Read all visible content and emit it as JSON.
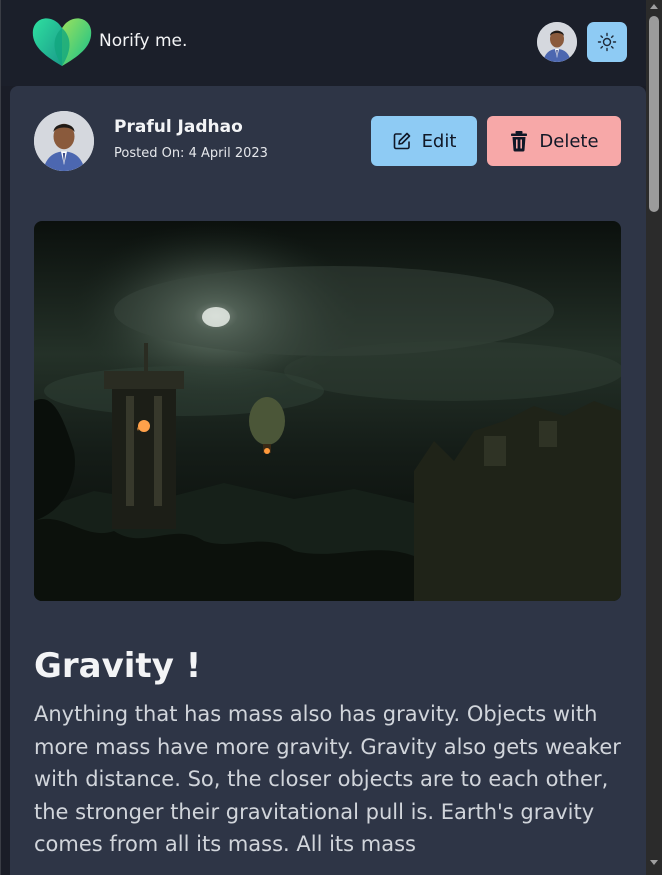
{
  "header": {
    "brand": "Norify me.",
    "icons": {
      "logo": "heart-logo",
      "avatar": "user-avatar",
      "theme": "sun-icon"
    },
    "accent": "#8ecbf4"
  },
  "post": {
    "author": "Praful Jadhao",
    "posted_on": "Posted On: 4 April 2023",
    "edit_label": "Edit",
    "delete_label": "Delete",
    "title": "Gravity !",
    "body": "Anything that has mass also has gravity. Objects with more mass have more gravity. Gravity also gets weaker with distance. So, the closer objects are to each other, the stronger their gravitational pull is. Earth's gravity comes from all its mass. All its mass",
    "image_icon": "fantasy-landscape-image",
    "colors": {
      "edit": "#8ecbf4",
      "delete": "#f7a8a8",
      "card": "#2e3546"
    }
  }
}
